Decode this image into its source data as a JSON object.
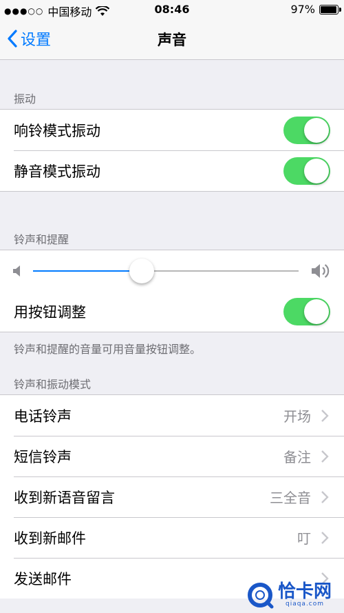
{
  "status_bar": {
    "signal": "●●●○○",
    "carrier": "中国移动",
    "time": "08:46",
    "battery": "97%",
    "battery_level": 0.97
  },
  "nav": {
    "back_label": "设置",
    "title": "声音"
  },
  "sections": {
    "vibration": {
      "header": "振动",
      "rows": [
        {
          "label": "响铃模式振动",
          "on": true
        },
        {
          "label": "静音模式振动",
          "on": true
        }
      ]
    },
    "ringer": {
      "header": "铃声和提醒",
      "volume_level": 0.41,
      "change_with_buttons": {
        "label": "用按钮调整",
        "on": true
      },
      "footer": "铃声和提醒的音量可用音量按钮调整。"
    },
    "patterns": {
      "header": "铃声和振动模式",
      "rows": [
        {
          "label": "电话铃声",
          "value": "开场"
        },
        {
          "label": "短信铃声",
          "value": "备注"
        },
        {
          "label": "收到新语音留言",
          "value": "三全音"
        },
        {
          "label": "收到新邮件",
          "value": "叮"
        },
        {
          "label": "发送邮件",
          "value": ""
        }
      ]
    }
  },
  "watermark": {
    "text": "恰卡网",
    "sub": "qiaqa.com"
  },
  "colors": {
    "accent": "#007aff",
    "toggle_on": "#4cd964",
    "background": "#efeff4"
  }
}
